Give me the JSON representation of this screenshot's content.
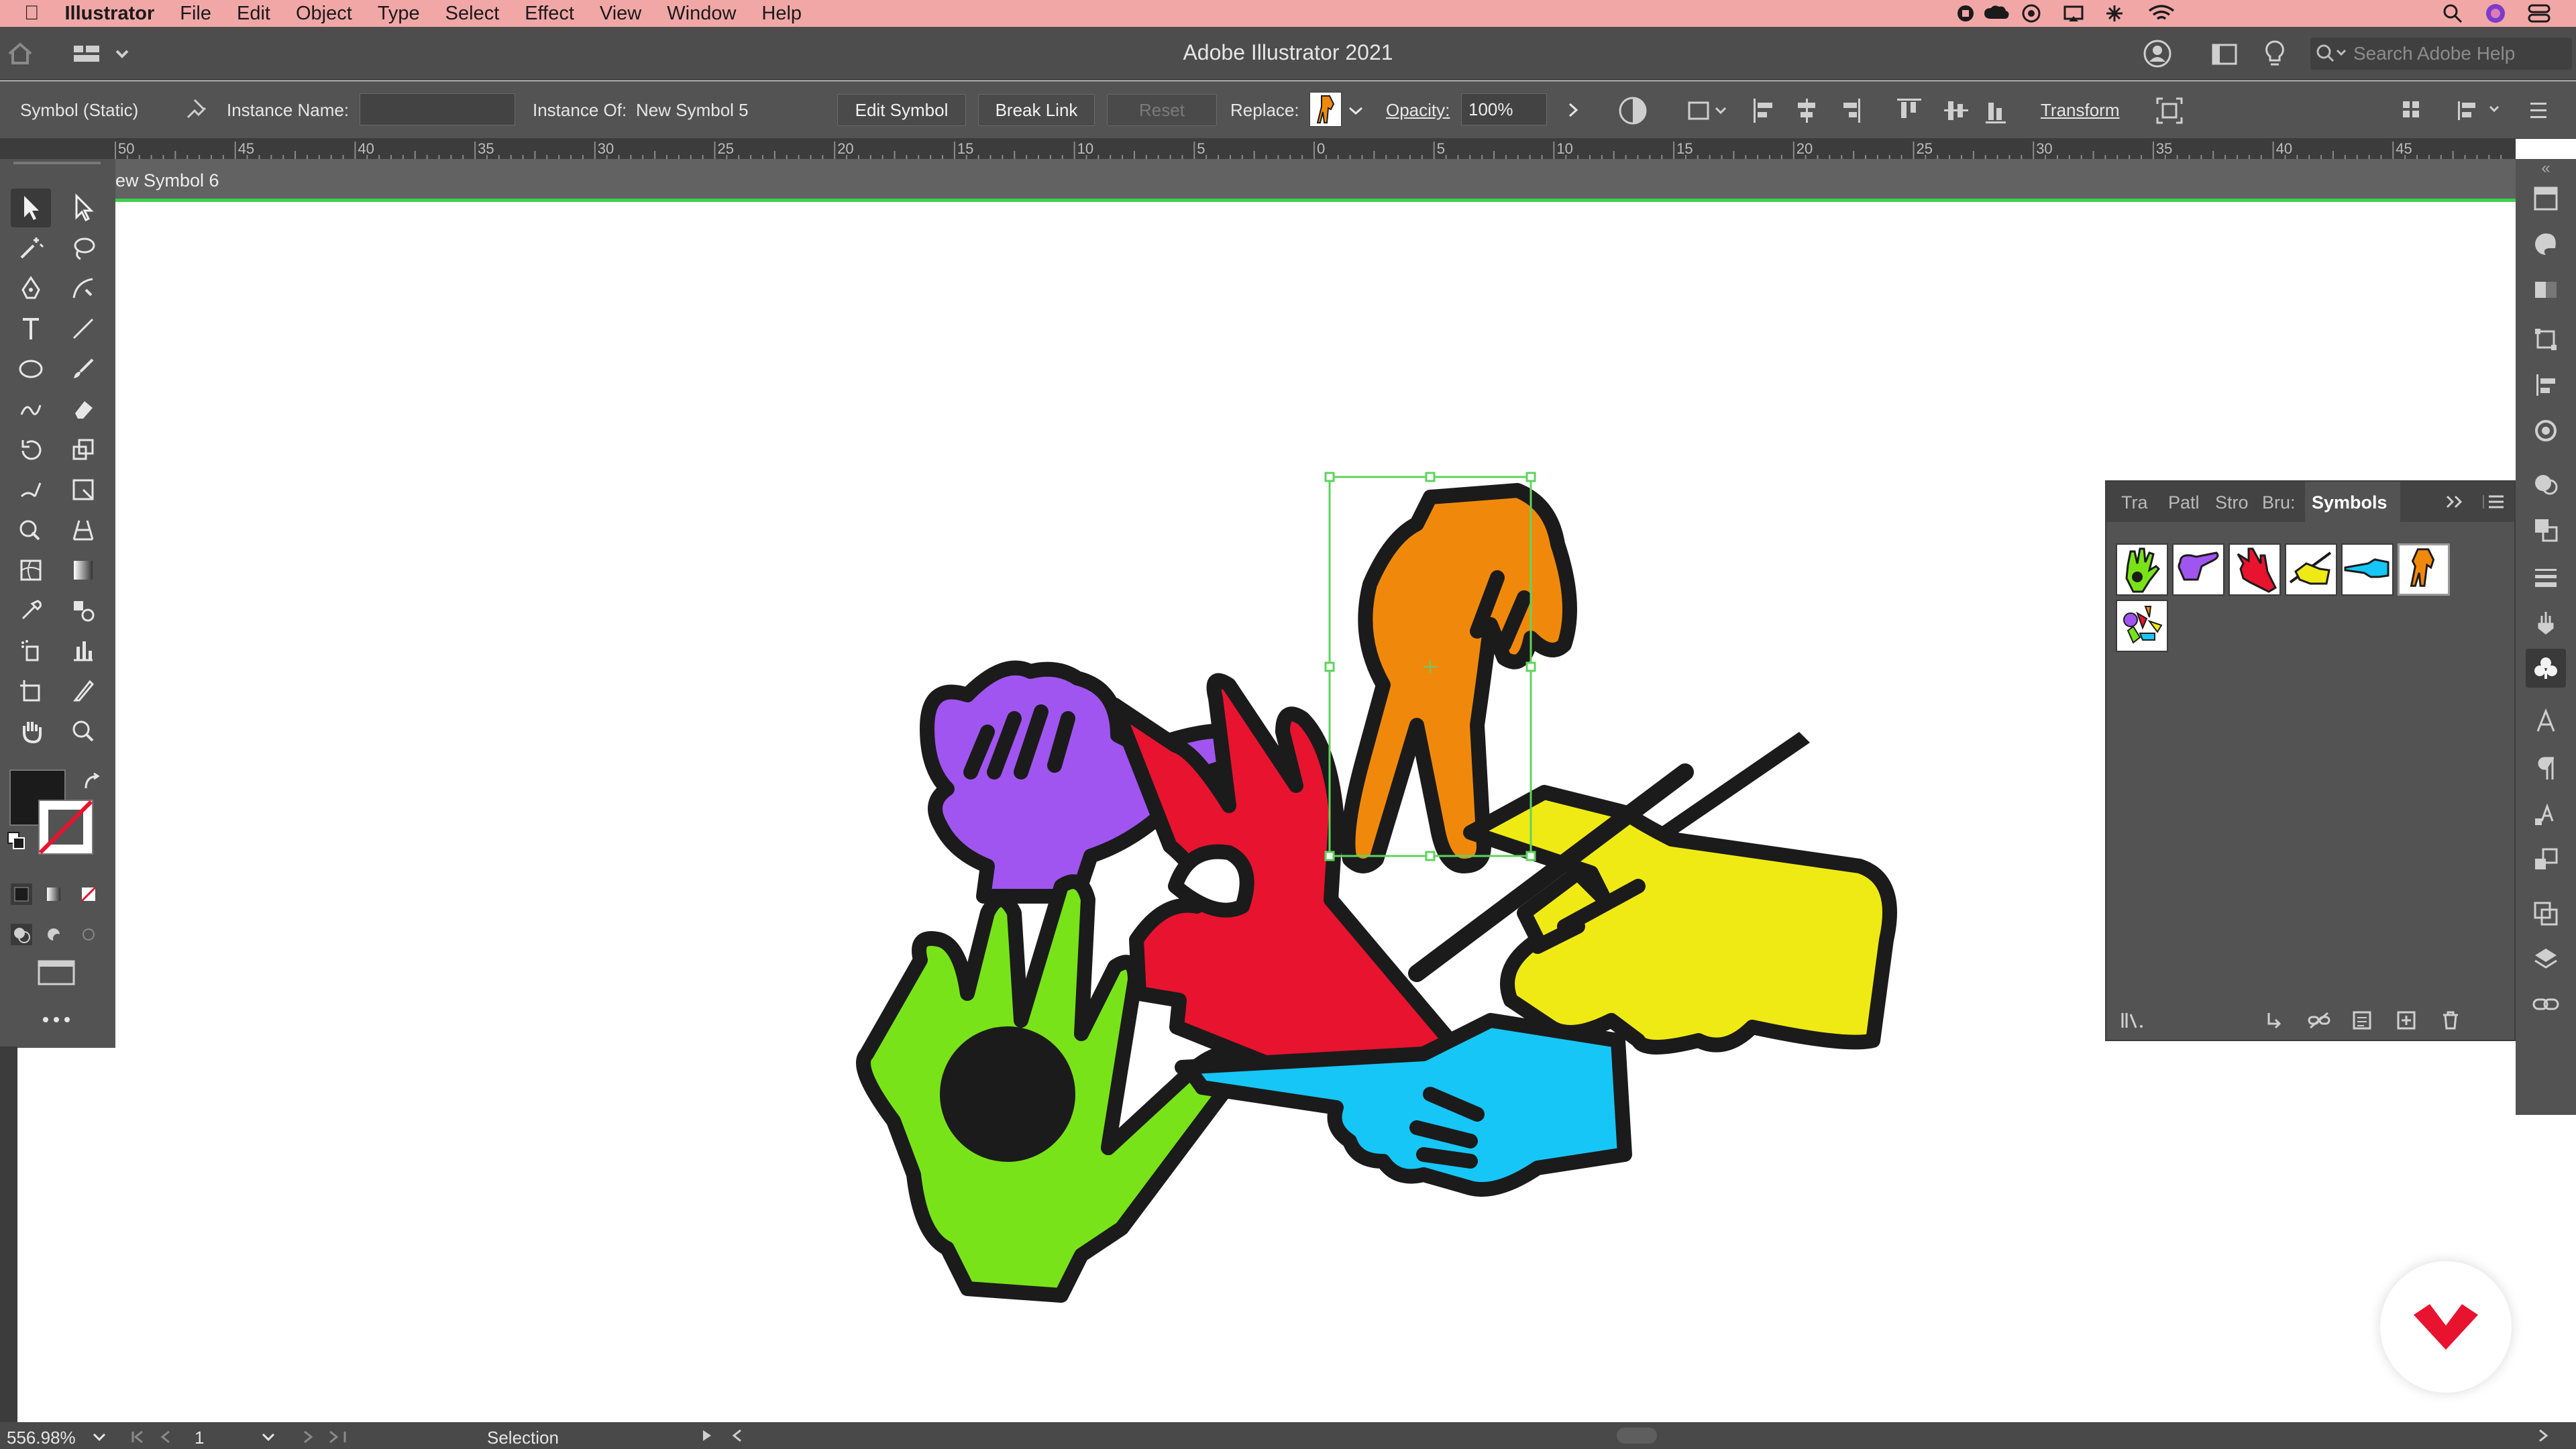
{
  "menubar": {
    "app_name": "Illustrator",
    "items": [
      "File",
      "Edit",
      "Object",
      "Type",
      "Select",
      "Effect",
      "View",
      "Window",
      "Help"
    ]
  },
  "window": {
    "title": "Adobe Illustrator 2021",
    "search_placeholder": "Search Adobe Help"
  },
  "control": {
    "selection_type": "Symbol (Static)",
    "instance_name_label": "Instance Name:",
    "instance_name_value": "",
    "instance_of_label": "Instance Of:",
    "instance_of_value": "New Symbol 5",
    "edit_symbol": "Edit Symbol",
    "break_link": "Break Link",
    "reset": "Reset",
    "replace_label": "Replace:",
    "opacity_label": "Opacity:",
    "opacity_value": "100%",
    "transform": "Transform"
  },
  "ruler": {
    "ticks": [
      "50",
      "45",
      "40",
      "35",
      "30",
      "25",
      "20",
      "15",
      "10",
      "5",
      "0",
      "5",
      "10",
      "15",
      "20",
      "25",
      "30",
      "35",
      "40",
      "45"
    ]
  },
  "document": {
    "tab_title": "ew Symbol 6"
  },
  "panel": {
    "tabs": [
      "Tra",
      "Patl",
      "Stro",
      "Bru:",
      "Symbols"
    ],
    "active_tab": "Symbols"
  },
  "status": {
    "zoom": "556.98%",
    "artboard": "1",
    "tool": "Selection"
  },
  "colors": {
    "orange": "#f0890b",
    "purple": "#a155f0",
    "red": "#e8132f",
    "yellow": "#f0ea14",
    "green": "#79e31a",
    "blue": "#16c6f6",
    "outline": "#1b1b1b",
    "menubar": "#f2a7a7",
    "selection": "#5fd35f",
    "brand": "#e8132f"
  }
}
